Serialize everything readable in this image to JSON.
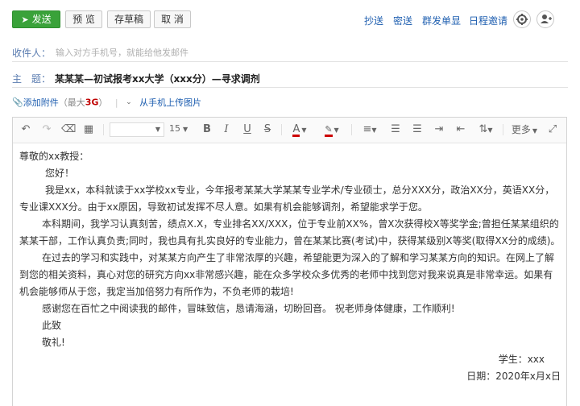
{
  "toolbar": {
    "send": "发送",
    "preview": "预 览",
    "draft": "存草稿",
    "cancel": "取 消",
    "links": [
      "抄送",
      "密送",
      "群发单显",
      "日程邀请"
    ]
  },
  "recipient": {
    "label": "收件人：",
    "placeholder": "输入对方手机号，就能给他发邮件"
  },
  "subject": {
    "label": "主　题：",
    "value": "某某某—初试报考xx大学（xxx分）—寻求调剂"
  },
  "attachment": {
    "add": "添加附件",
    "max_prefix": "（最大",
    "max_value": "3G",
    "max_suffix": "）",
    "upload_phone": "从手机上传图片"
  },
  "editor_toolbar": {
    "font_size": "15",
    "more": "更多"
  },
  "body": {
    "greeting": "尊敬的xx教授：",
    "hello": "您好！",
    "p1": "我是xx，本科就读于xx学校xx专业，今年报考某某大学某某专业学术/专业硕士，总分XXX分，政治XX分，英语XX分，专业课XXX分。由于xx原因，导致初试发挥不尽人意。如果有机会能够调剂，希望能求学于您。",
    "p2": "本科期间，我学习认真刻苦，绩点X.X，专业排名XX/XXX，位于专业前XX%，曾X次获得校X等奖学金;曾担任某某组织的某某干部，工作认真负责;同时，我也具有扎实良好的专业能力，曾在某某比赛(考试)中，获得某级别X等奖(取得XX分的成绩)。",
    "p3": "在过去的学习和实践中，对某某方向产生了非常浓厚的兴趣，希望能更为深入的了解和学习某某方向的知识。在网上了解到您的相关资料，真心对您的研究方向xx非常感兴趣，能在众多学校众多优秀的老师中找到您对我来说真是非常幸运。如果有机会能够师从于您，我定当加倍努力有所作为，不负老师的栽培!",
    "p4": "感谢您在百忙之中阅读我的邮件，冒昧致信，恳请海涵，切盼回音。 祝老师身体健康，工作顺利!",
    "closing1": "此致",
    "closing2": "敬礼!",
    "sign_student": "学生：xxx",
    "sign_date": "日期：2020年x月x日"
  }
}
